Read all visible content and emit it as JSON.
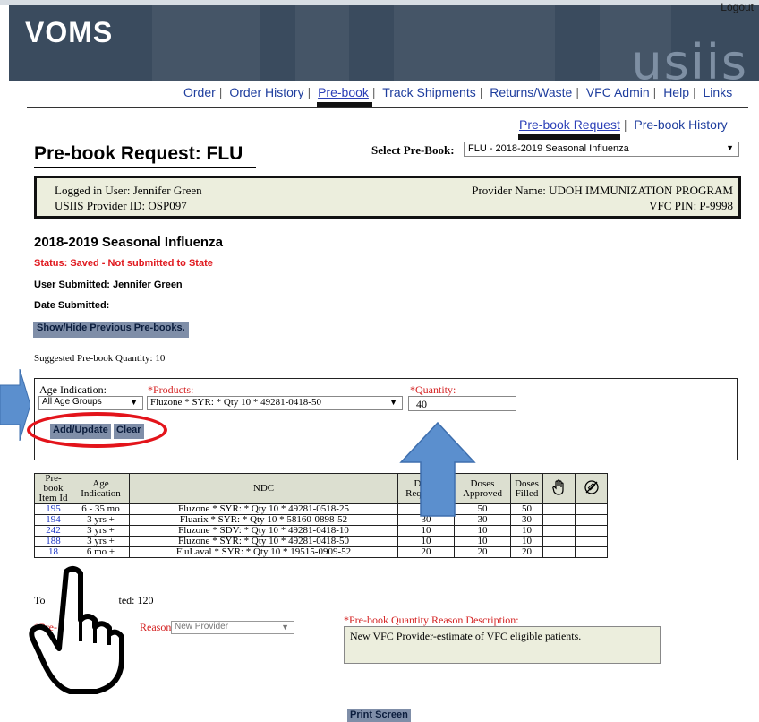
{
  "header": {
    "logout_label": "Logout",
    "app_title": "VOMS",
    "wordmark": "usiis",
    "colors": {
      "banner": "#3a4b5e",
      "link": "#1f3e9e",
      "button": "#7f8ea8",
      "required": "#d42020"
    }
  },
  "main_nav": {
    "items": [
      "Order",
      "Order History",
      "Pre-book",
      "Track Shipments",
      "Returns/Waste",
      "VFC Admin",
      "Help",
      "Links"
    ],
    "active": "Pre-book"
  },
  "sub_nav": {
    "items": [
      "Pre-book Request",
      "Pre-book History"
    ],
    "active": "Pre-book Request"
  },
  "page": {
    "title": "Pre-book Request: FLU",
    "select_label": "Select Pre-Book:",
    "select_value": "FLU - 2018-2019 Seasonal Influenza"
  },
  "info_box": {
    "logged_in_user": "Logged in User: Jennifer Green",
    "provider_id": "USIIS Provider ID: OSP097",
    "provider_name": "Provider Name: UDOH IMMUNIZATION PROGRAM",
    "vfc_pin": "VFC PIN: P-9998"
  },
  "season": {
    "title": "2018-2019 Seasonal Influenza",
    "status_label": "Status:",
    "status_value": "Saved - Not submitted to State",
    "user_submitted": "User Submitted: Jennifer Green",
    "date_submitted": "Date Submitted:",
    "show_hide_label": "Show/Hide Previous Pre-books.",
    "suggested_qty": "Suggested Pre-book Quantity: 10"
  },
  "form": {
    "age_label": "Age Indication:",
    "age_value": "All Age Groups",
    "products_label": "*Products:",
    "products_value": "Fluzone * SYR: * Qty 10 * 49281-0418-50",
    "qty_label": "*Quantity:",
    "qty_value": "40",
    "add_update_label": "Add/Update",
    "clear_label": "Clear"
  },
  "table": {
    "headers": [
      "Pre-book Item Id",
      "Age Indication",
      "NDC",
      "Doses Requested",
      "Doses Approved",
      "Doses Filled"
    ],
    "icon_headers": [
      "hand-stop-icon",
      "syringe-cancel-icon"
    ],
    "rows": [
      {
        "id": "195",
        "age": "6 - 35 mo",
        "ndc": "Fluzone * SYR: * Qty 10 * 49281-0518-25",
        "requested": "50",
        "approved": "50",
        "filled": "50"
      },
      {
        "id": "194",
        "age": "3 yrs +",
        "ndc": "Fluarix * SYR: * Qty 10 * 58160-0898-52",
        "requested": "30",
        "approved": "30",
        "filled": "30"
      },
      {
        "id": "242",
        "age": "3 yrs +",
        "ndc": "Fluzone * SDV: * Qty 10 * 49281-0418-10",
        "requested": "10",
        "approved": "10",
        "filled": "10"
      },
      {
        "id": "188",
        "age": "3 yrs +",
        "ndc": "Fluzone * SYR: * Qty 10 * 49281-0418-50",
        "requested": "10",
        "approved": "10",
        "filled": "10"
      },
      {
        "id": "18",
        "age": "6 mo +",
        "ndc": "FluLaval * SYR: * Qty 10 * 19515-0909-52",
        "requested": "20",
        "approved": "20",
        "filled": "20"
      }
    ]
  },
  "totals": {
    "text_left": "To",
    "text_right": "ted: 120"
  },
  "reason": {
    "label_left": "*Pre-",
    "label_right": "Reason:",
    "select_value": "New Provider",
    "desc_label": "*Pre-book Quantity Reason Description:",
    "desc_value": "New VFC Provider-estimate of VFC eligible patients."
  },
  "footer": {
    "print_label": "Print Screen"
  }
}
